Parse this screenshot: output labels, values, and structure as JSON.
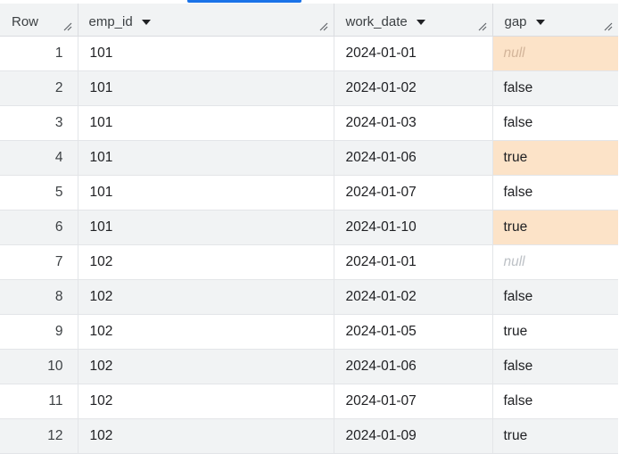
{
  "columns": [
    {
      "key": "row",
      "label": "Row"
    },
    {
      "key": "emp_id",
      "label": "emp_id"
    },
    {
      "key": "work_date",
      "label": "work_date"
    },
    {
      "key": "gap",
      "label": "gap"
    }
  ],
  "rows": [
    {
      "row": "1",
      "emp_id": "101",
      "work_date": "2024-01-01",
      "gap": "null",
      "highlighted": true
    },
    {
      "row": "2",
      "emp_id": "101",
      "work_date": "2024-01-02",
      "gap": "false",
      "highlighted": false
    },
    {
      "row": "3",
      "emp_id": "101",
      "work_date": "2024-01-03",
      "gap": "false",
      "highlighted": false
    },
    {
      "row": "4",
      "emp_id": "101",
      "work_date": "2024-01-06",
      "gap": "true",
      "highlighted": true
    },
    {
      "row": "5",
      "emp_id": "101",
      "work_date": "2024-01-07",
      "gap": "false",
      "highlighted": false
    },
    {
      "row": "6",
      "emp_id": "101",
      "work_date": "2024-01-10",
      "gap": "true",
      "highlighted": true
    },
    {
      "row": "7",
      "emp_id": "102",
      "work_date": "2024-01-01",
      "gap": "null",
      "highlighted": false
    },
    {
      "row": "8",
      "emp_id": "102",
      "work_date": "2024-01-02",
      "gap": "false",
      "highlighted": false
    },
    {
      "row": "9",
      "emp_id": "102",
      "work_date": "2024-01-05",
      "gap": "true",
      "highlighted": false
    },
    {
      "row": "10",
      "emp_id": "102",
      "work_date": "2024-01-06",
      "gap": "false",
      "highlighted": false
    },
    {
      "row": "11",
      "emp_id": "102",
      "work_date": "2024-01-07",
      "gap": "false",
      "highlighted": false
    },
    {
      "row": "12",
      "emp_id": "102",
      "work_date": "2024-01-09",
      "gap": "true",
      "highlighted": false
    }
  ],
  "icons": {
    "sort": "caret-down-icon",
    "resize": "column-resize-handle-icon"
  },
  "colors": {
    "accent": "#1a73e8",
    "highlight": "#fce3c8",
    "header_bg": "#f1f3f4",
    "stripe_bg": "#f1f3f4",
    "null_text": "#bdc1c6"
  }
}
